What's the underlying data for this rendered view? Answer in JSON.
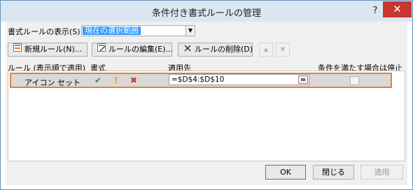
{
  "window": {
    "title": "条件付き書式ルールの管理",
    "help": "?",
    "close": "✕"
  },
  "scope": {
    "label": "書式ルールの表示(S):",
    "selected": "現在の選択範囲",
    "arrow": "▼"
  },
  "toolbar": {
    "new_rule": "新規ルール(N)...",
    "edit_rule": "ルールの編集(E)...",
    "delete_rule": "ルールの削除(D)",
    "move_up": "▲",
    "move_down": "▼"
  },
  "headers": {
    "rule": "ルール (表示順で適用)",
    "format": "書式",
    "applies_to": "適用先",
    "stop_if_true": "条件を満たす場合は停止"
  },
  "rules": [
    {
      "name": "アイコン セット",
      "icons": [
        "✔",
        "!",
        "✖"
      ],
      "icon_colors": [
        "#2e8b3a",
        "#e8a000",
        "#c0392b"
      ],
      "applies_to": "=$D$4:$D$10",
      "stop_if_true": false
    }
  ],
  "footer": {
    "ok": "OK",
    "close": "閉じる",
    "apply": "適用"
  }
}
